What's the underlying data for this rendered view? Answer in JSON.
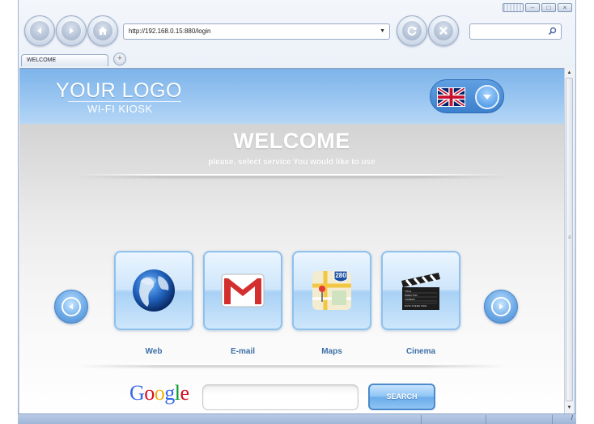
{
  "browser": {
    "address": "http://192.168.0.15:880/login",
    "search_placeholder": "",
    "tabs": [
      {
        "label": "WELCOME"
      }
    ],
    "new_tab_label": "+",
    "window_controls": [
      "restore-grid",
      "minimize",
      "maximize",
      "close"
    ]
  },
  "header": {
    "logo_title": "YOUR LOGO",
    "logo_subtitle": "WI-FI KIOSK",
    "language_flag": "uk-flag-icon"
  },
  "main": {
    "title": "WELCOME",
    "subtitle": "please, select service You would like to use",
    "services": [
      {
        "label": "Web",
        "icon": "globe-icon"
      },
      {
        "label": "E-mail",
        "icon": "gmail-icon"
      },
      {
        "label": "Maps",
        "icon": "maps-icon",
        "badge": "280"
      },
      {
        "label": "Cinema",
        "icon": "clapperboard-icon"
      }
    ],
    "clapper_lines": [
      "TITLE",
      "DIRECTOR",
      "CAMERA",
      "DATE  SCENE  TAKE"
    ]
  },
  "google": {
    "logo_letters": [
      "G",
      "o",
      "o",
      "g",
      "l",
      "e"
    ],
    "logo_colors": [
      "#3369e8",
      "#d50f25",
      "#eeb211",
      "#3369e8",
      "#009925",
      "#d50f25"
    ],
    "input_value": "",
    "button_label": "SEARCH"
  },
  "colors": {
    "header_blue": "#8dbfef",
    "tile_border": "#8fc1ec",
    "label_blue": "#3d6fa8"
  }
}
